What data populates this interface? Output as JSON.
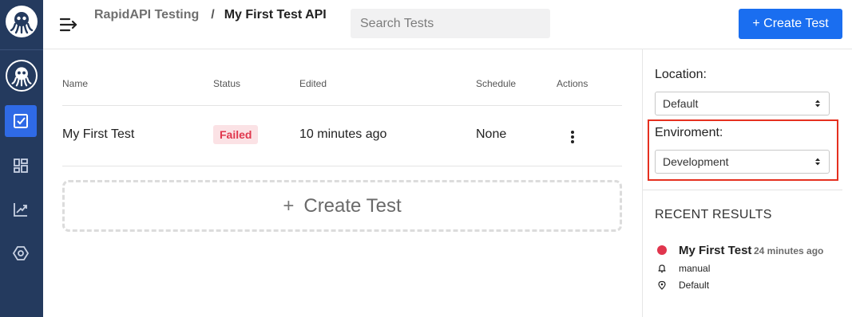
{
  "header": {
    "breadcrumb_root": "RapidAPI Testing",
    "breadcrumb_separator": "/",
    "breadcrumb_current": "My First Test API",
    "search_placeholder": "Search Tests",
    "create_button": "+ Create Test"
  },
  "sidebar": {
    "items": [
      {
        "icon": "logo-icon"
      },
      {
        "icon": "tests-icon",
        "active": true
      },
      {
        "icon": "dashboard-icon"
      },
      {
        "icon": "analytics-icon"
      },
      {
        "icon": "settings-icon"
      }
    ]
  },
  "table": {
    "columns": [
      "Name",
      "Status",
      "Edited",
      "Schedule",
      "Actions"
    ],
    "rows": [
      {
        "name": "My First Test",
        "status": "Failed",
        "edited": "10 minutes ago",
        "schedule": "None"
      }
    ]
  },
  "create_card": {
    "plus": "+",
    "label": "Create Test"
  },
  "right_panel": {
    "location_label": "Location:",
    "location_value": "Default",
    "environment_label": "Enviroment:",
    "environment_value": "Development",
    "recent_title": "RECENT RESULTS",
    "recent": {
      "name": "My First Test",
      "time": "24 minutes ago",
      "trigger": "manual",
      "location": "Default"
    }
  },
  "colors": {
    "sidebar_bg": "#243a5e",
    "primary": "#1a6ef0",
    "failed": "#e0374d",
    "highlight": "#e5301f"
  }
}
